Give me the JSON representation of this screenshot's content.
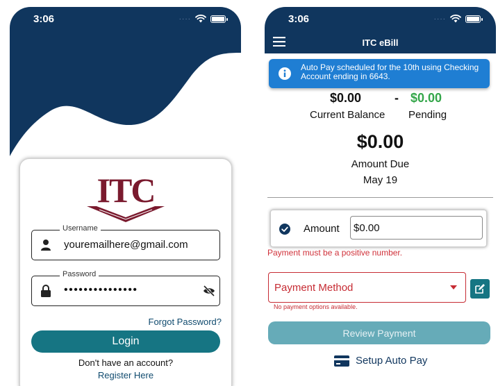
{
  "status_time": "3:06",
  "login_screen": {
    "logo_text": "ITC",
    "username_label": "Username",
    "username_value": "youremailhere@gmail.com",
    "password_label": "Password",
    "password_masked": "•••••••••••••••",
    "forgot_link": "Forgot Password?",
    "login_button": "Login",
    "no_account_text": "Don't have an account?",
    "register_link": "Register Here"
  },
  "ebill_screen": {
    "title": "ITC eBill",
    "toast_message": "Auto Pay scheduled for the 10th using Checking Account ending in 6643.",
    "current_balance_amount": "$0.00",
    "current_balance_label": "Current Balance",
    "separator": "-",
    "pending_amount": "$0.00",
    "pending_label": "Pending",
    "amount_due": "$0.00",
    "amount_due_label": "Amount Due",
    "due_date": "May 19",
    "amount_label": "Amount",
    "amount_value": "$0.00",
    "amount_error": "Payment must be a positive number.",
    "payment_method_label": "Payment Method",
    "payment_method_error": "No payment options available.",
    "review_button": "Review Payment",
    "setup_autopay_link": "Setup Auto Pay"
  },
  "colors": {
    "navy": "#10365e",
    "teal": "#167583",
    "teal_disabled": "#66abb8",
    "toast_blue": "#1f7ed3",
    "error_red": "#c62b33",
    "pending_green": "#34a64a",
    "logo_maroon": "#7a1a2e"
  },
  "icons": [
    "wifi-icon",
    "battery-icon",
    "person-icon",
    "lock-icon",
    "eye-off-icon",
    "menu-icon",
    "info-icon",
    "check-circle-icon",
    "caret-down-icon",
    "edit-icon",
    "credit-card-icon"
  ]
}
